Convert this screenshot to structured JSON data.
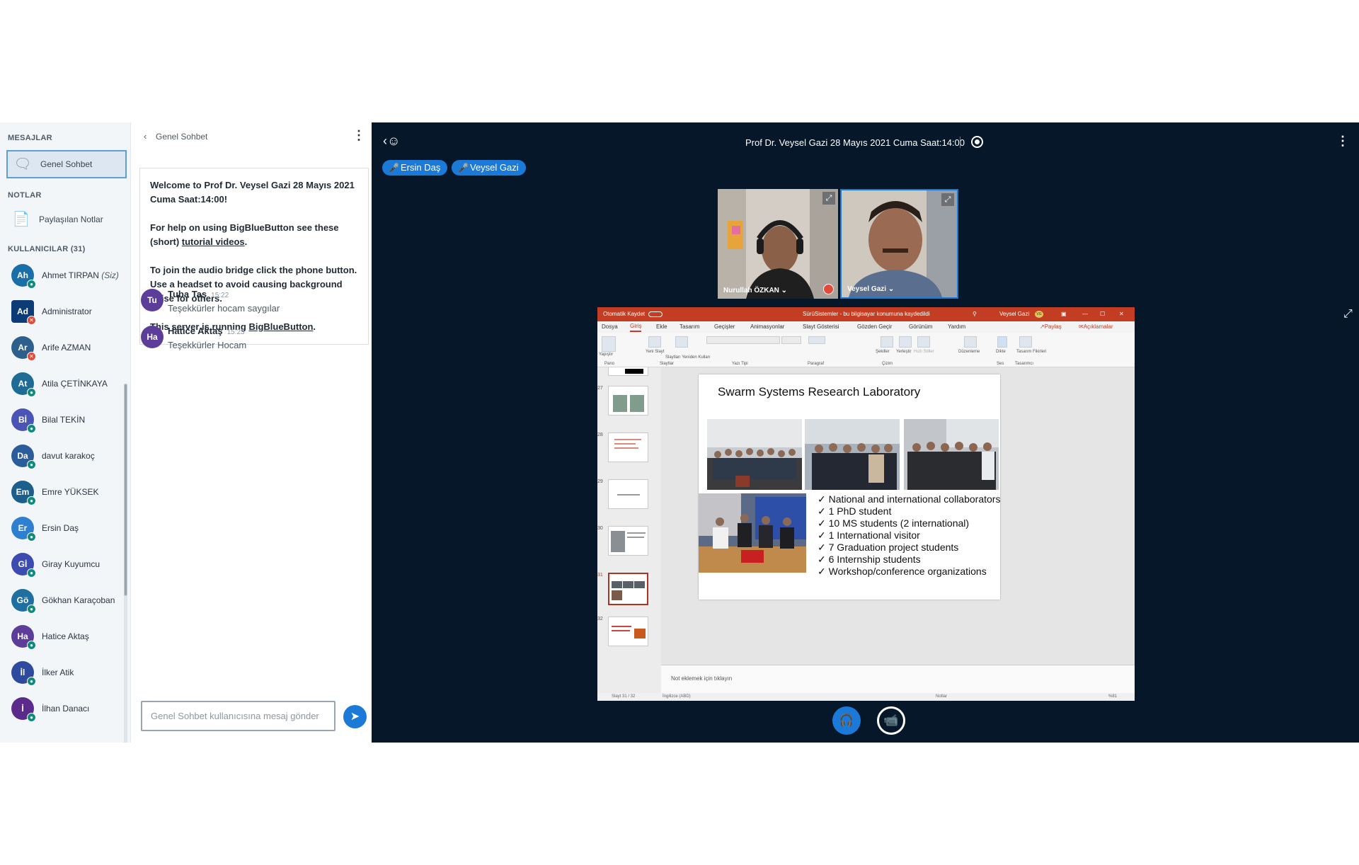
{
  "sidebar": {
    "messages_title": "MESAJLAR",
    "public_chat": "Genel Sohbet",
    "notes_title": "NOTLAR",
    "shared_notes": "Paylaşılan Notlar",
    "users_title": "KULLANICILAR (31)",
    "you_suffix": "(Siz)",
    "users": [
      {
        "initials": "Ah",
        "name": "Ahmet TIRPAN",
        "color": "#1b6fa8",
        "badge": "listen"
      },
      {
        "initials": "Ad",
        "name": "Administrator",
        "color": "#0c3b75",
        "badge": "muted"
      },
      {
        "initials": "Ar",
        "name": "Arife AZMAN",
        "color": "#2d5f8d",
        "badge": "muted"
      },
      {
        "initials": "At",
        "name": "Atila ÇETİNKAYA",
        "color": "#1e6b95",
        "badge": "listen"
      },
      {
        "initials": "Bİ",
        "name": "Bilal TEKİN",
        "color": "#4a54b5",
        "badge": "listen"
      },
      {
        "initials": "Da",
        "name": "davut karakoç",
        "color": "#2b5d9a",
        "badge": "listen"
      },
      {
        "initials": "Em",
        "name": "Emre YÜKSEK",
        "color": "#1c5f8c",
        "badge": "listen"
      },
      {
        "initials": "Er",
        "name": "Ersin Daş",
        "color": "#2e7fd0",
        "badge": "listen"
      },
      {
        "initials": "Gİ",
        "name": "Giray Kuyumcu",
        "color": "#3c4bb0",
        "badge": "listen"
      },
      {
        "initials": "Gö",
        "name": "Gökhan Karaçoban",
        "color": "#1f70a0",
        "badge": "listen"
      },
      {
        "initials": "Ha",
        "name": "Hatice Aktaş",
        "color": "#5c3d99",
        "badge": "listen"
      },
      {
        "initials": "İl",
        "name": "İlker Atik",
        "color": "#2d4a9c",
        "badge": "listen"
      },
      {
        "initials": "İ",
        "name": "İlhan Danacı",
        "color": "#5b2b8c",
        "badge": "listen"
      }
    ]
  },
  "chat": {
    "title": "Genel Sohbet",
    "welcome": {
      "line1": "Welcome to Prof Dr. Veysel Gazi 28 Mayıs 2021 Cuma Saat:14:00!",
      "help_pre": "For help on using BigBlueButton see these (short) ",
      "help_link": "tutorial videos",
      "help_post": ".",
      "audio": "To join the audio bridge click the phone button. Use a headset to avoid causing background noise for others.",
      "server_pre": "This server is running ",
      "server_link": "BigBlueButton",
      "server_post": "."
    },
    "messages": [
      {
        "initials": "Tu",
        "name": "Tuba Taş",
        "time": "15:22",
        "text": "Teşekkürler hocam saygılar"
      },
      {
        "initials": "Ha",
        "name": "Hatice Aktaş",
        "time": "15:23",
        "text": "Teşekkürler Hocam"
      }
    ],
    "input_placeholder": "Genel Sohbet kullanıcısına mesaj gönder"
  },
  "meeting": {
    "title": "Prof Dr. Veysel Gazi 28 Mayıs 2021 Cuma Saat:14:00",
    "talkers": [
      "Ersin Daş",
      "Veysel Gazi"
    ],
    "cameras": [
      "Nurullah ÖZKAN",
      "Veysel Gazi"
    ]
  },
  "ppt": {
    "autosave": "Otomatik Kaydet",
    "filename": "SürüSistemler - bu bilgisayar konumuna kaydedildi",
    "user": "Veysel Gazi",
    "user_initials": "VG",
    "menu": [
      "Dosya",
      "Giriş",
      "Ekle",
      "Tasarım",
      "Geçişler",
      "Animasyonlar",
      "Slayt Gösterisi",
      "Gözden Geçir",
      "Görünüm",
      "Yardım"
    ],
    "share": "Paylaş",
    "comments": "Açıklamalar",
    "groups": [
      "Pano",
      "Slaytlar",
      "Yazı Tipi",
      "Paragraf",
      "Çizim",
      "Ses",
      "Tasarımcı"
    ],
    "ribbon_labels": [
      "Yapıştır",
      "Yeni Slayt",
      "Slaytları Yeniden Kullan",
      "Şekiller",
      "Yerleştir",
      "Hızlı Stiller",
      "Düzenleme",
      "Dikte",
      "Tasarım Fikirleri"
    ],
    "thumb_numbers": [
      "27",
      "28",
      "29",
      "30",
      "31",
      "32"
    ],
    "slide": {
      "title": "Swarm Systems Research Laboratory",
      "bullets": [
        "National and international collaborators",
        "1 PhD student",
        "10 MS students (2 international)",
        "1 International visitor",
        "7 Graduation project students",
        "6 Internship students",
        "Workshop/conference organizations"
      ]
    },
    "notes_placeholder": "Not eklemek için tıklayın",
    "status_slide": "Slayt 31 / 32",
    "status_lang": "İngilizce (ABD)",
    "status_notes": "Notlar",
    "zoom": "%81"
  },
  "colors": {
    "main_bg": "#06172a",
    "primary": "#1b7ad8",
    "ppt_red": "#c33d23"
  }
}
